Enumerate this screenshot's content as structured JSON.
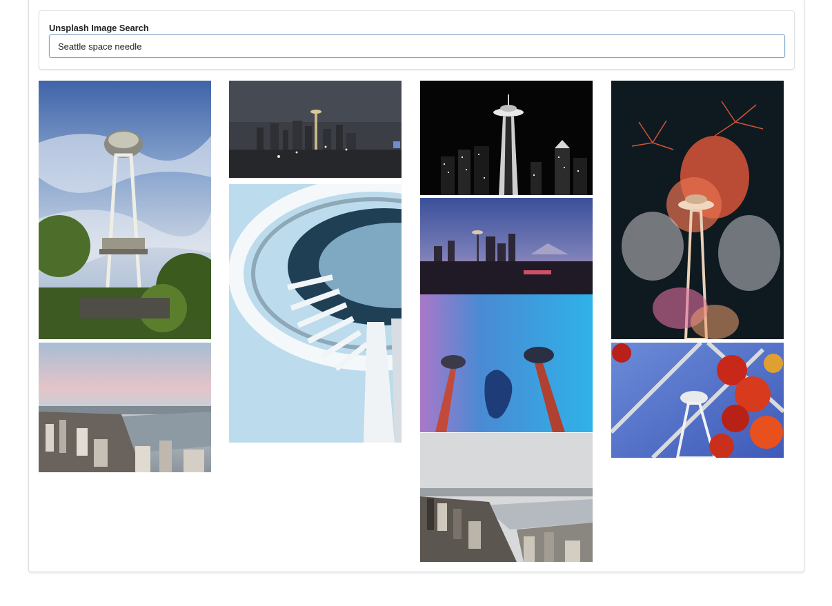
{
  "search": {
    "label": "Unsplash Image Search",
    "query": "Seattle space needle"
  },
  "results": [
    {
      "id": "p1",
      "subject": "space-needle-daytime-clouds"
    },
    {
      "id": "p2",
      "subject": "seattle-city-waterfront-dusk"
    },
    {
      "id": "p3",
      "subject": "seattle-skyline-night-distant"
    },
    {
      "id": "p4",
      "subject": "space-needle-saucer-closeup"
    },
    {
      "id": "p5",
      "subject": "space-needle-night-bw"
    },
    {
      "id": "p6",
      "subject": "seattle-skyline-twilight-rainier"
    },
    {
      "id": "p7",
      "subject": "space-needle-reflection-blue"
    },
    {
      "id": "p8",
      "subject": "seattle-aerial-overcast"
    },
    {
      "id": "p9",
      "subject": "space-needle-fireworks"
    },
    {
      "id": "p10",
      "subject": "space-needle-glass-flowers"
    }
  ],
  "colors": {
    "input_border": "#7ea6c9",
    "card_border": "#e2e2e2",
    "text": "#222222"
  }
}
